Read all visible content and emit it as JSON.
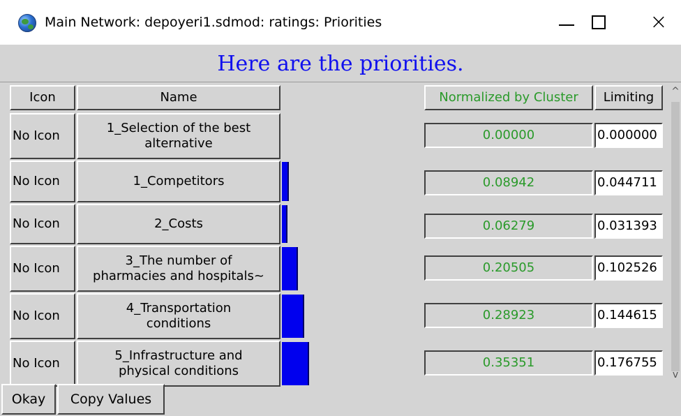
{
  "window": {
    "title": "Main Network: depoyeri1.sdmod: ratings: Priorities",
    "app_icon": "globe-icon",
    "controls": {
      "minimize": "minimize-icon",
      "maximize": "maximize-icon",
      "close": "close-icon",
      "close_glyph": "×"
    }
  },
  "heading": "Here are the priorities.",
  "columns": {
    "icon": "Icon",
    "name": "Name",
    "normalized": "Normalized by Cluster",
    "limiting": "Limiting"
  },
  "rows": [
    {
      "icon": "No Icon",
      "name_line1": "1_Selection of the best",
      "name_line2": "alternative",
      "normalized": "0.00000",
      "limiting": "0.000000",
      "bar_fraction": 0.0
    },
    {
      "icon": "No Icon",
      "name_line1": "1_Competitors",
      "name_line2": "",
      "normalized": "0.08942",
      "limiting": "0.044711",
      "bar_fraction": 0.08942
    },
    {
      "icon": "No Icon",
      "name_line1": "2_Costs",
      "name_line2": "",
      "normalized": "0.06279",
      "limiting": "0.031393",
      "bar_fraction": 0.06279
    },
    {
      "icon": "No Icon",
      "name_line1": "3_The number of",
      "name_line2": "pharmacies and hospitals~",
      "normalized": "0.20505",
      "limiting": "0.102526",
      "bar_fraction": 0.20505
    },
    {
      "icon": "No Icon",
      "name_line1": "4_Transportation",
      "name_line2": "conditions",
      "normalized": "0.28923",
      "limiting": "0.144615",
      "bar_fraction": 0.28923
    },
    {
      "icon": "No Icon",
      "name_line1": "5_Infrastructure and",
      "name_line2": "physical conditions",
      "normalized": "0.35351",
      "limiting": "0.176755",
      "bar_fraction": 0.35351
    }
  ],
  "buttons": {
    "okay": "Okay",
    "copy_values": "Copy Values"
  },
  "colors": {
    "heading": "#1010ee",
    "values": "#2a9a2a",
    "bar": "#0000ee"
  }
}
